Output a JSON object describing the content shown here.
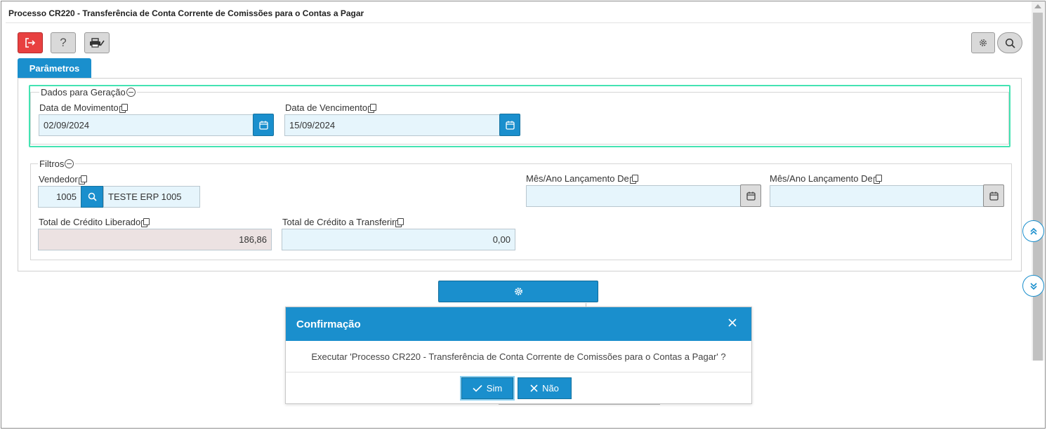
{
  "window": {
    "title": "Processo CR220 - Transferência de Conta Corrente de Comissões para o Contas a Pagar"
  },
  "toolbar": {
    "exit_icon": "exit-icon",
    "help_label": "?",
    "print_icon": "printer-icon",
    "settings_icon": "gear-icon",
    "search_icon": "search-icon"
  },
  "tabs": [
    {
      "label": "Parâmetros",
      "active": true
    }
  ],
  "section_geracao": {
    "legend": "Dados para Geração",
    "data_movimento": {
      "label": "Data de Movimento",
      "value": "02/09/2024"
    },
    "data_vencimento": {
      "label": "Data de Vencimento",
      "value": "15/09/2024"
    }
  },
  "section_filtros": {
    "legend": "Filtros",
    "vendedor": {
      "label": "Vendedor",
      "code": "1005",
      "name": "TESTE ERP 1005"
    },
    "mes_ano_de_1": {
      "label": "Mês/Ano Lançamento De",
      "value": ""
    },
    "mes_ano_de_2": {
      "label": "Mês/Ano Lançamento De",
      "value": ""
    },
    "total_credito_liberado": {
      "label": "Total de Crédito Liberado",
      "value": "186,86"
    },
    "total_credito_transferir": {
      "label": "Total de Crédito a Transferir",
      "value": "0,00"
    }
  },
  "modal": {
    "title": "Confirmação",
    "message": "Executar 'Processo CR220 - Transferência de Conta Corrente de Comissões para o Contas a Pagar' ?",
    "yes_label": "Sim",
    "no_label": "Não"
  },
  "colors": {
    "primary": "#1a8fcd",
    "danger": "#e84040",
    "highlight": "#44e3b2"
  }
}
